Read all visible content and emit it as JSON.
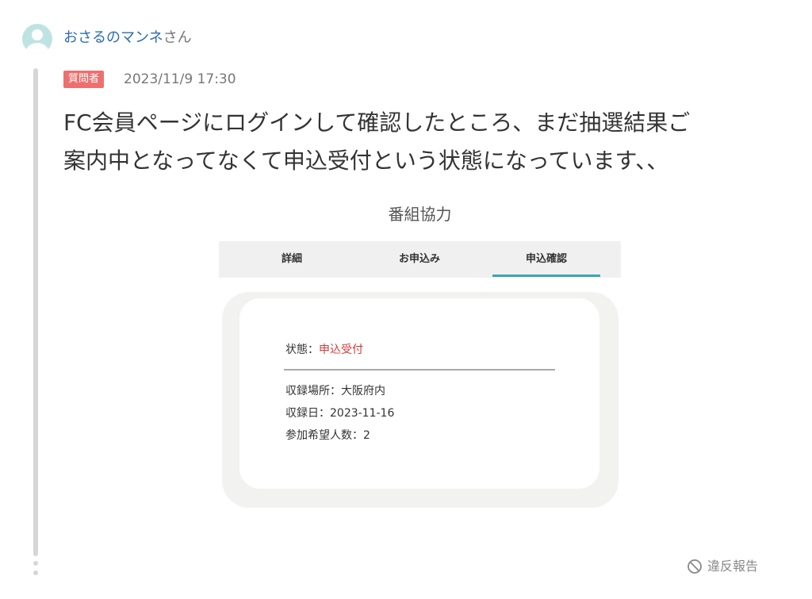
{
  "user": {
    "name": "おさるのマンネ",
    "suffix": "さん"
  },
  "post": {
    "badge": "質問者",
    "timestamp": "2023/11/9 17:30",
    "text_lines": [
      "FC会員ページにログインして確認したところ、まだ抽選結果ご",
      "案内中となってなくて申込受付という状態になっています、、"
    ]
  },
  "embedded_screenshot": {
    "title": "番組協力",
    "tabs": [
      "詳細",
      "お申込み",
      "申込確認"
    ],
    "active_tab": "申込確認",
    "status_label": "状態：",
    "status_value": "申込受付",
    "details": [
      "収録場所：大阪府内",
      "収録日：2023-11-16",
      "参加希望人数：2"
    ]
  },
  "actions": {
    "report_label": "違反報告"
  },
  "colors": {
    "username": "#2b6bb6",
    "badge_bg": "#ee6f6f",
    "status_value": "#d03a3a",
    "active_tab_underline": "#3ba6b6"
  },
  "icons": {
    "avatar": "default-user-avatar-icon",
    "report": "ban-icon"
  }
}
